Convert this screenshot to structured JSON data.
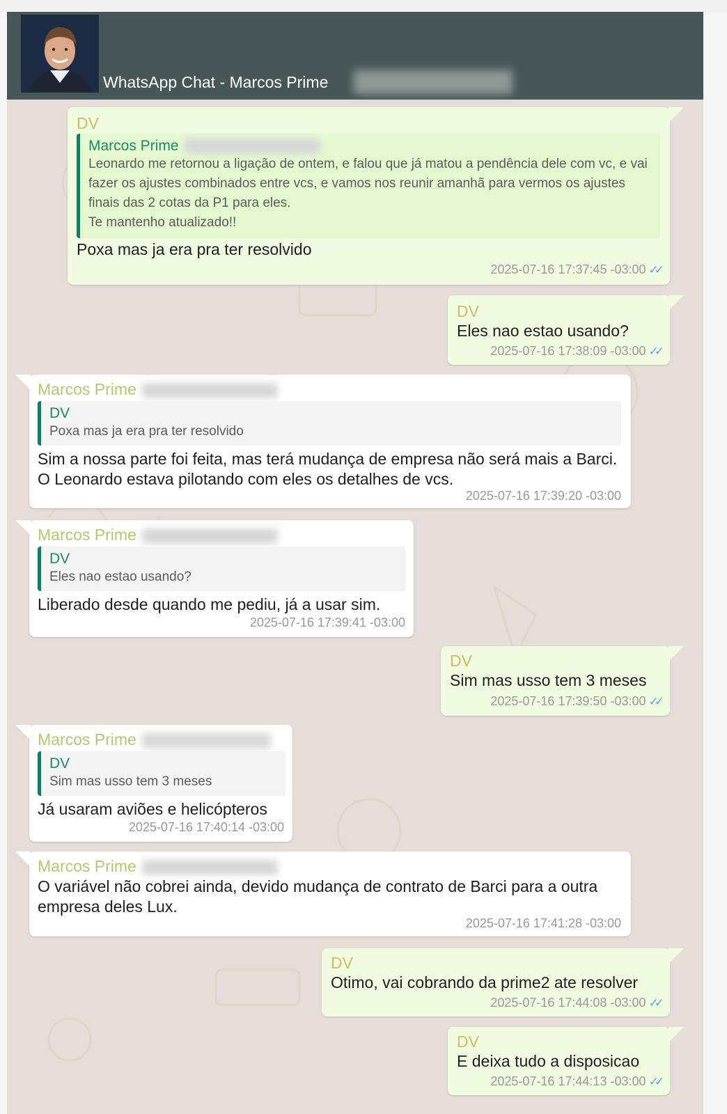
{
  "header": {
    "title": "WhatsApp Chat - Marcos Prime"
  },
  "colors": {
    "header_bg": "#475757",
    "outgoing_bubble": "#f0fbe2",
    "incoming_bubble": "#ffffff",
    "chat_bg": "#e6ded6",
    "read_ticks": "#5aa9e6"
  },
  "messages": [
    {
      "direction": "out",
      "sender": "DV",
      "quote": {
        "name": "Marcos Prime",
        "text": "Leonardo me retornou a ligação de ontem, e falou que já matou a pendência dele com vc, e vai fazer os ajustes combinados entre vcs, e vamos nos reunir amanhã para vermos os ajustes finais das 2 cotas da P1 para eles.\nTe mantenho atualizado!!"
      },
      "text": "Poxa mas ja era pra ter resolvido",
      "time": "2025-07-16 17:37:45 -03:00",
      "ticks_icon": "double-check-icon"
    },
    {
      "direction": "out",
      "sender": "DV",
      "text": "Eles nao estao usando?",
      "time": "2025-07-16 17:38:09 -03:00",
      "ticks_icon": "double-check-icon"
    },
    {
      "direction": "in",
      "sender": "Marcos Prime",
      "quote": {
        "name": "DV",
        "text": "Poxa mas ja era pra ter resolvido"
      },
      "text": "Sim a nossa parte foi feita, mas terá mudança de empresa não será mais a Barci. O Leonardo estava pilotando com eles os detalhes de vcs.",
      "time": "2025-07-16 17:39:20 -03:00"
    },
    {
      "direction": "in",
      "sender": "Marcos Prime",
      "quote": {
        "name": "DV",
        "text": "Eles nao estao usando?"
      },
      "text": "Liberado desde quando me pediu, já a usar sim.",
      "time": "2025-07-16 17:39:41 -03:00"
    },
    {
      "direction": "out",
      "sender": "DV",
      "text": "Sim mas usso tem 3 meses",
      "time": "2025-07-16 17:39:50 -03:00",
      "ticks_icon": "double-check-icon"
    },
    {
      "direction": "in",
      "sender": "Marcos Prime",
      "quote": {
        "name": "DV",
        "text": "Sim mas usso tem 3 meses"
      },
      "text": "Já usaram aviões e helicópteros",
      "time": "2025-07-16 17:40:14 -03:00"
    },
    {
      "direction": "in",
      "sender": "Marcos Prime",
      "text": "O variável não cobrei ainda, devido mudança de contrato de Barci para a outra empresa deles Lux.",
      "time": "2025-07-16 17:41:28 -03:00"
    },
    {
      "direction": "out",
      "sender": "DV",
      "text": "Otimo, vai cobrando da prime2 ate resolver",
      "time": "2025-07-16 17:44:08 -03:00",
      "ticks_icon": "double-check-icon"
    },
    {
      "direction": "out",
      "sender": "DV",
      "text": "E deixa tudo a disposicao",
      "time": "2025-07-16 17:44:13 -03:00",
      "ticks_icon": "double-check-icon"
    }
  ]
}
